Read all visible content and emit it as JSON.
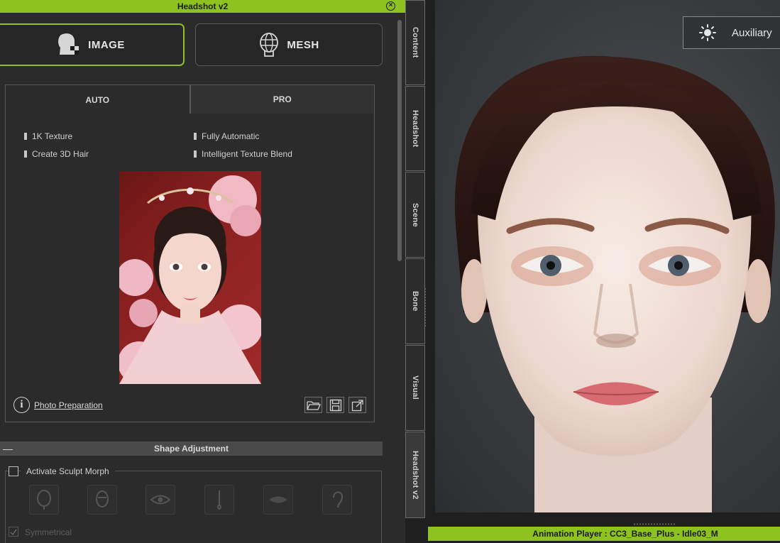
{
  "window": {
    "title": "Headshot v2"
  },
  "mode_buttons": {
    "image": "IMAGE",
    "mesh": "MESH"
  },
  "tabs": {
    "auto": "AUTO",
    "pro": "PRO"
  },
  "features": [
    "1K Texture",
    "Fully Automatic",
    "Create 3D Hair",
    "Intelligent Texture Blend"
  ],
  "photo_prep": "Photo Preparation",
  "shape_adjustment": {
    "title": "Shape Adjustment",
    "activate_label": "Activate Sculpt Morph",
    "symmetrical_label": "Symmetrical"
  },
  "side_tabs": [
    "Content",
    "Headshot",
    "Scene",
    "Bone",
    "Visual",
    "Headshot v2"
  ],
  "viewport": {
    "aux_label": "Auxiliary",
    "animation_player": "Animation Player : CC3_Base_Plus - Idle03_M"
  },
  "colors": {
    "accent": "#8dc21f",
    "panel": "#2b2b2b"
  },
  "icons": {
    "image_mode": "face-checker-icon",
    "mesh_mode": "head-mesh-icon",
    "info": "info-icon",
    "open": "folder-open-icon",
    "save": "save-icon",
    "export": "export-icon",
    "sun": "sun-icon"
  }
}
